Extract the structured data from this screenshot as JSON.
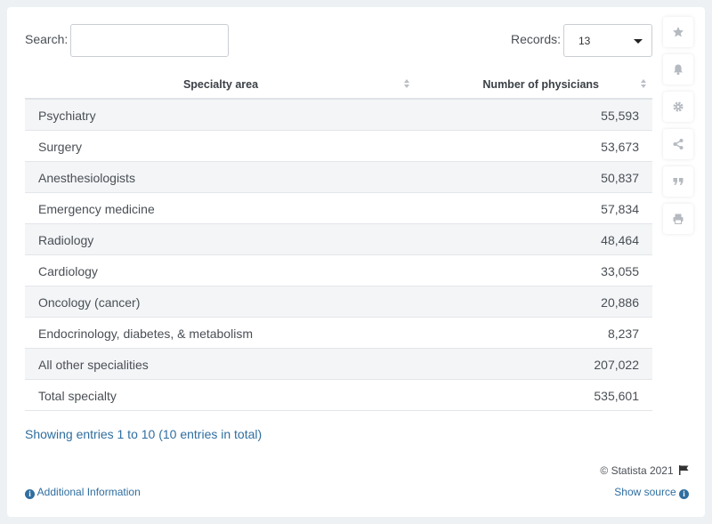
{
  "search": {
    "label": "Search:",
    "value": "",
    "placeholder": ""
  },
  "records": {
    "label": "Records:",
    "selected": "13"
  },
  "table": {
    "headers": [
      "Specialty area",
      "Number of physicians"
    ],
    "rows": [
      {
        "specialty": "Psychiatry",
        "count": "55,593"
      },
      {
        "specialty": "Surgery",
        "count": "53,673"
      },
      {
        "specialty": "Anesthesiologists",
        "count": "50,837"
      },
      {
        "specialty": "Emergency medicine",
        "count": "57,834"
      },
      {
        "specialty": "Radiology",
        "count": "48,464"
      },
      {
        "specialty": "Cardiology",
        "count": "33,055"
      },
      {
        "specialty": "Oncology (cancer)",
        "count": "20,886"
      },
      {
        "specialty": "Endocrinology, diabetes, & metabolism",
        "count": "8,237"
      },
      {
        "specialty": "All other specialities",
        "count": "207,022"
      },
      {
        "specialty": "Total specialty",
        "count": "535,601"
      }
    ]
  },
  "footer": {
    "entries_info": "Showing entries 1 to 10 (10 entries in total)",
    "copyright": "© Statista 2021",
    "additional_info": "Additional Information",
    "show_source": "Show source"
  },
  "toolbar": {
    "icons": [
      "star-icon",
      "bell-icon",
      "gear-icon",
      "share-icon",
      "quote-icon",
      "print-icon"
    ]
  },
  "colors": {
    "link": "#2f6ea0",
    "row_stripe": "#f3f5f7",
    "text": "#4a4f55",
    "icon": "#b5bac0"
  }
}
